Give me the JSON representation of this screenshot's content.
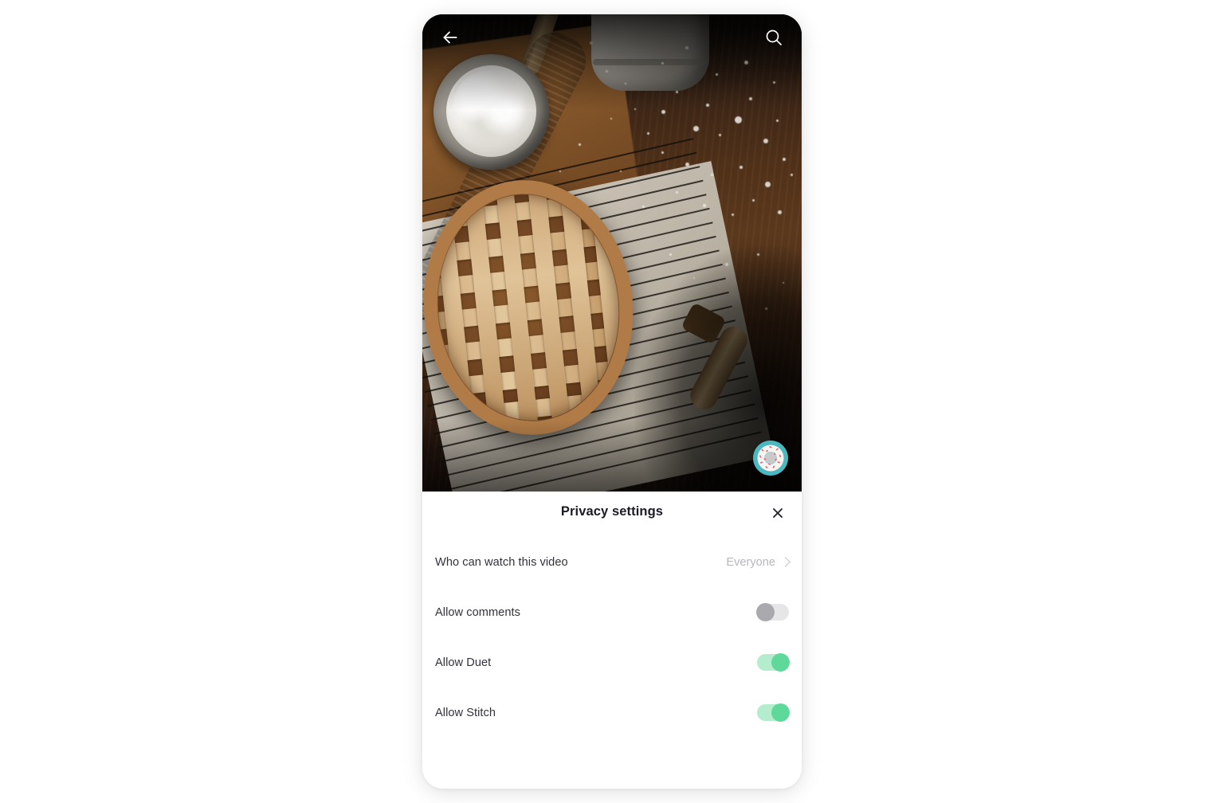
{
  "app": {
    "screen_name": "video-privacy-settings"
  },
  "video": {
    "topbar": {
      "back_icon": "back-arrow-icon",
      "search_icon": "search-icon"
    },
    "music_disc": {
      "icon": "donut-music-disc-icon",
      "colors": {
        "ring": "#4bb8c0",
        "frosting": "#f4f1ee",
        "sprinkles": "#e06a72",
        "hole": "#c9c9c9"
      }
    },
    "scene_description": "Lattice-top baked pie on a wire cooling rack with parchment, wooden rolling pin, bowl of flour and a ceramic crock on a dark wooden table"
  },
  "sheet": {
    "title": "Privacy settings",
    "close_icon": "close-icon",
    "rows": [
      {
        "label": "Who can watch this video",
        "type": "navigation",
        "value": "Everyone",
        "chevron_icon": "chevron-right-icon"
      },
      {
        "label": "Allow comments",
        "type": "toggle",
        "state": "off"
      },
      {
        "label": "Allow Duet",
        "type": "toggle",
        "state": "on"
      },
      {
        "label": "Allow Stitch",
        "type": "toggle",
        "state": "on"
      }
    ]
  },
  "colors": {
    "page_background": "#ffffff",
    "sheet_background": "#ffffff",
    "title_text": "#1b1b23",
    "label_text": "#32323c",
    "value_text": "#b7b7bd",
    "toggle_on_track": "#b4ecce",
    "toggle_on_knob": "#5fd99a",
    "toggle_off_track": "#e6e6e8",
    "toggle_off_knob": "#a9a9ae"
  }
}
